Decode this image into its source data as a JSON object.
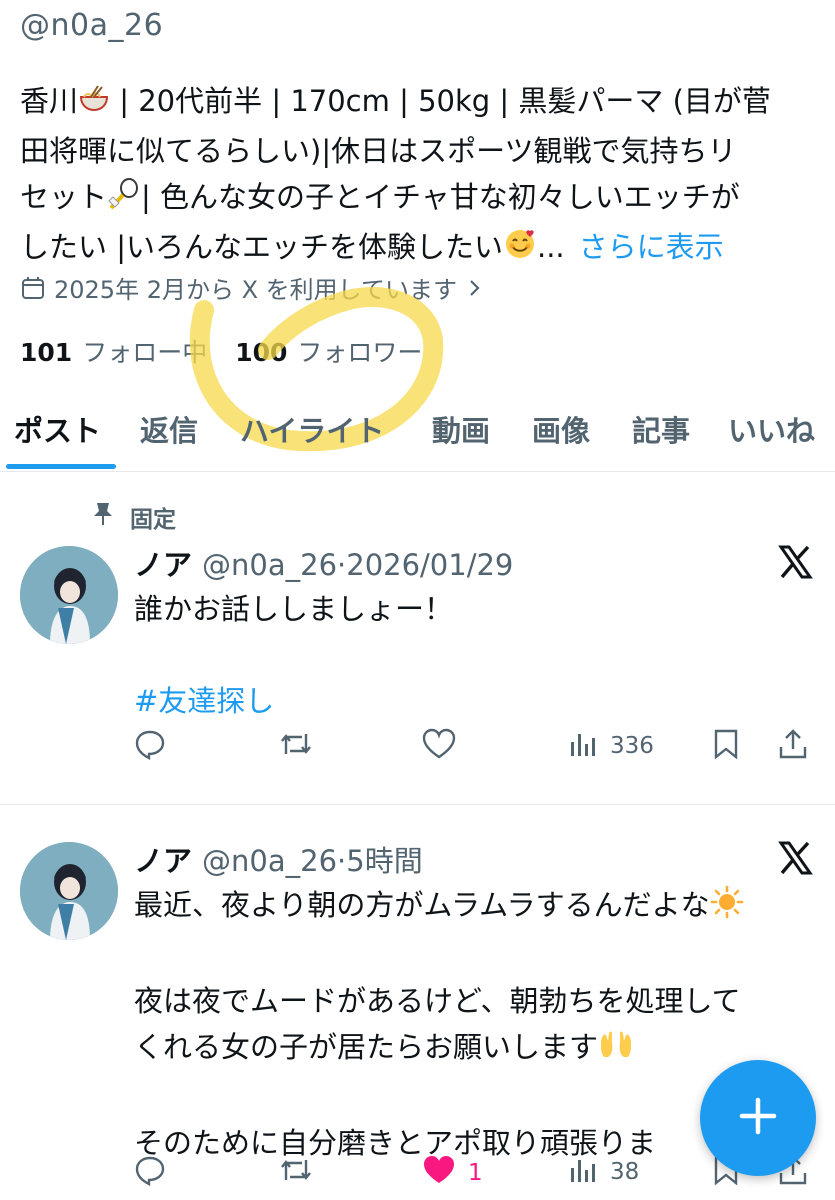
{
  "profile": {
    "handle": "@n0a_26",
    "bio_line1": "香川",
    "bio_line1_rest": " | 20代前半 | 170cm | 50kg | 黒髪パーマ (目が菅",
    "bio_line2": "田将暉に似てるらしい)|休日はスポーツ観戦で気持ちリ",
    "bio_line3": "セット",
    "bio_line3_rest": "| 色んな女の子とイチャ甘な初々しいエッチが",
    "bio_line4": "したい |いろんなエッチを体験したい",
    "bio_ellipsis": "...",
    "show_more": "さらに表示",
    "joined": "2025年 2月から X を利用しています",
    "following_count": "101",
    "following_label": "フォロー中",
    "followers_count": "100",
    "followers_label": "フォロワー"
  },
  "tabs": [
    "ポスト",
    "返信",
    "ハイライト",
    "動画",
    "画像",
    "記事",
    "いいね"
  ],
  "pinned_label": "固定",
  "posts": [
    {
      "name": "ノア",
      "meta": "@n0a_26·2026/01/29",
      "line1": "誰かお話ししましょー！",
      "hashtag": "#友達探し",
      "views": "336",
      "likes": ""
    },
    {
      "name": "ノア",
      "meta": "@n0a_26·5時間",
      "line1": "最近、夜より朝の方がムラムラするんだよな",
      "line2": "夜は夜でムードがあるけど、朝勃ちを処理して",
      "line3": "くれる女の子が居たらお願いします",
      "line4": "そのために自分磨きとアポ取り頑張りま",
      "likes": "1",
      "views": "38"
    }
  ],
  "colors": {
    "accent": "#1d9bf0",
    "like": "#f91880",
    "secondary_text": "#536471",
    "highlight_marker": "#f7d94c"
  },
  "icons": {
    "ramen": "ramen-emoji",
    "racket": "badminton-emoji",
    "smile": "smiling-face-with-hearts-emoji",
    "sun": "sun-emoji",
    "hands": "palms-up-emoji"
  }
}
